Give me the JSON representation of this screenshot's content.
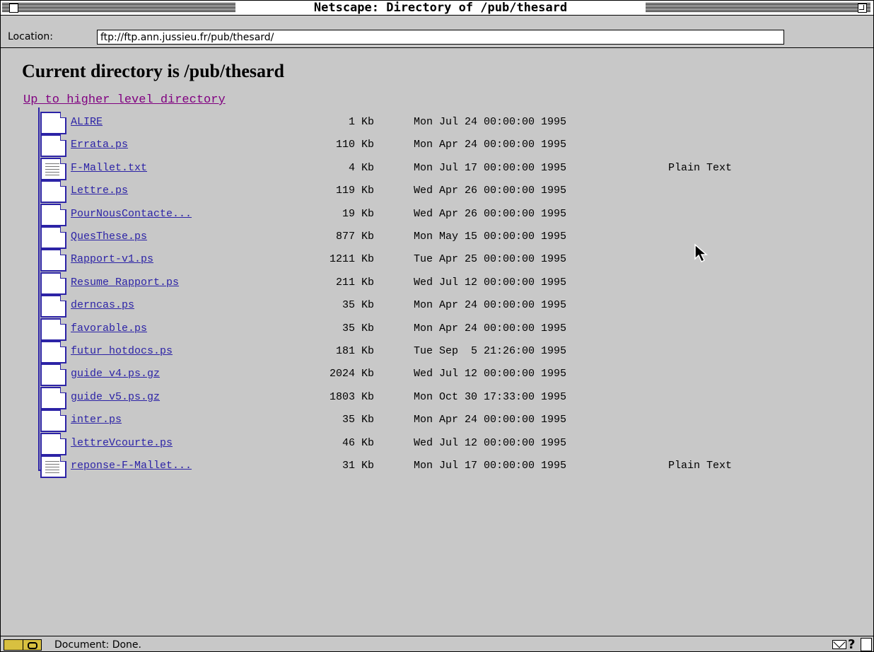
{
  "window": {
    "title": "Netscape: Directory of /pub/thesard"
  },
  "location": {
    "label": "Location:",
    "url": "ftp://ftp.ann.jussieu.fr/pub/thesard/"
  },
  "page": {
    "heading": "Current directory is /pub/thesard",
    "up_link": "Up to higher level directory",
    "files": [
      {
        "icon": "document-icon",
        "name": "ALIRE",
        "size": "1 Kb",
        "date": "Mon Jul 24 00:00:00 1995",
        "type": ""
      },
      {
        "icon": "document-icon",
        "name": "Errata.ps",
        "size": "110 Kb",
        "date": "Mon Apr 24 00:00:00 1995",
        "type": ""
      },
      {
        "icon": "text-file-icon",
        "name": "F-Mallet.txt",
        "size": "4 Kb",
        "date": "Mon Jul 17 00:00:00 1995",
        "type": "Plain Text"
      },
      {
        "icon": "document-icon",
        "name": "Lettre.ps",
        "size": "119 Kb",
        "date": "Wed Apr 26 00:00:00 1995",
        "type": ""
      },
      {
        "icon": "document-icon",
        "name": "PourNousContacte...",
        "size": "19 Kb",
        "date": "Wed Apr 26 00:00:00 1995",
        "type": ""
      },
      {
        "icon": "document-icon",
        "name": "QuesThese.ps",
        "size": "877 Kb",
        "date": "Mon May 15 00:00:00 1995",
        "type": ""
      },
      {
        "icon": "document-icon",
        "name": "Rapport-v1.ps",
        "size": "1211 Kb",
        "date": "Tue Apr 25 00:00:00 1995",
        "type": ""
      },
      {
        "icon": "document-icon",
        "name": "Resume_Rapport.ps",
        "size": "211 Kb",
        "date": "Wed Jul 12 00:00:00 1995",
        "type": ""
      },
      {
        "icon": "document-icon",
        "name": "derncas.ps",
        "size": "35 Kb",
        "date": "Mon Apr 24 00:00:00 1995",
        "type": ""
      },
      {
        "icon": "document-icon",
        "name": "favorable.ps",
        "size": "35 Kb",
        "date": "Mon Apr 24 00:00:00 1995",
        "type": ""
      },
      {
        "icon": "document-icon",
        "name": "futur_hotdocs.ps",
        "size": "181 Kb",
        "date": "Tue Sep  5 21:26:00 1995",
        "type": ""
      },
      {
        "icon": "document-icon",
        "name": "guide_v4.ps.gz",
        "size": "2024 Kb",
        "date": "Wed Jul 12 00:00:00 1995",
        "type": ""
      },
      {
        "icon": "document-icon",
        "name": "guide_v5.ps.gz",
        "size": "1803 Kb",
        "date": "Mon Oct 30 17:33:00 1995",
        "type": ""
      },
      {
        "icon": "document-icon",
        "name": "inter.ps",
        "size": "35 Kb",
        "date": "Mon Apr 24 00:00:00 1995",
        "type": ""
      },
      {
        "icon": "document-icon",
        "name": "lettreVcourte.ps",
        "size": "46 Kb",
        "date": "Wed Jul 12 00:00:00 1995",
        "type": ""
      },
      {
        "icon": "text-file-icon",
        "name": "reponse-F-Mallet...",
        "size": "31 Kb",
        "date": "Mon Jul 17 00:00:00 1995",
        "type": "Plain Text"
      }
    ]
  },
  "status": {
    "text": "Document: Done."
  },
  "colors": {
    "link": "#2c23a6",
    "visited_link": "#800080",
    "background": "#c8c8c8"
  }
}
